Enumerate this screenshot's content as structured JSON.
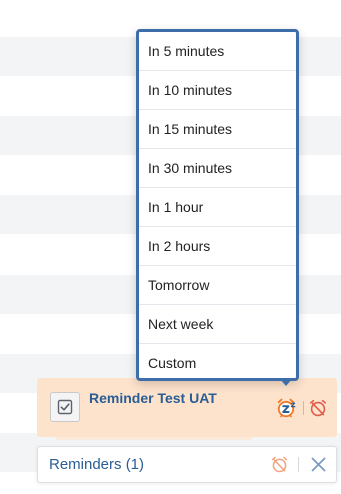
{
  "snooze_menu": {
    "options": [
      "In 5 minutes",
      "In 10 minutes",
      "In 15 minutes",
      "In 30 minutes",
      "In 1 hour",
      "In 2 hours",
      "Tomorrow",
      "Next week",
      "Custom"
    ]
  },
  "reminder": {
    "title": "Reminder Test UAT",
    "icons": {
      "complete": "checkbox-icon",
      "snooze": "alarm-snooze-icon",
      "dismiss": "alarm-off-icon"
    }
  },
  "reminders_bar": {
    "title": "Reminders (1)",
    "icons": {
      "dismiss_all": "alarm-off-icon",
      "close": "close-icon"
    }
  },
  "colors": {
    "menu_border": "#3e6eaa",
    "card_background": "#fde3cc",
    "title_blue": "#2b5d95",
    "icon_orange": "#f07a2a",
    "icon_red": "#e25b4b",
    "close_blue": "#7d9cc4",
    "stripe": "#f3f4f6"
  }
}
